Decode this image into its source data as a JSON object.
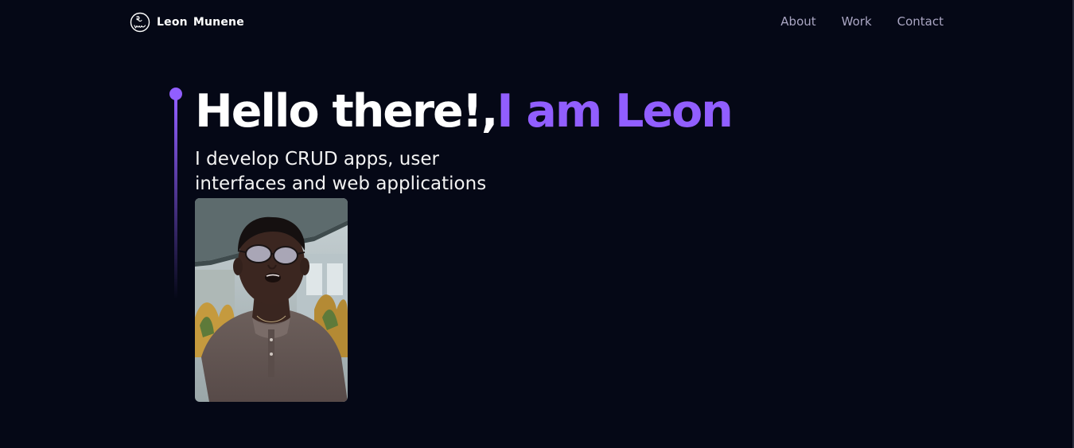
{
  "colors": {
    "background": "#050816",
    "accent": "#915eff",
    "nav_text": "#aaa6c3",
    "heading_text": "#ffffff"
  },
  "nav": {
    "logo_icon": "signature-logo-icon",
    "brand_name": "Leon  Munene",
    "links": [
      {
        "label": "About"
      },
      {
        "label": "Work"
      },
      {
        "label": "Contact"
      }
    ]
  },
  "hero": {
    "greeting": "Hello there!,",
    "name": "I am Leon",
    "subtitle_line1": "I develop CRUD apps, user",
    "subtitle_line2": "interfaces and web applications",
    "photo_icon": "profile-photo"
  }
}
